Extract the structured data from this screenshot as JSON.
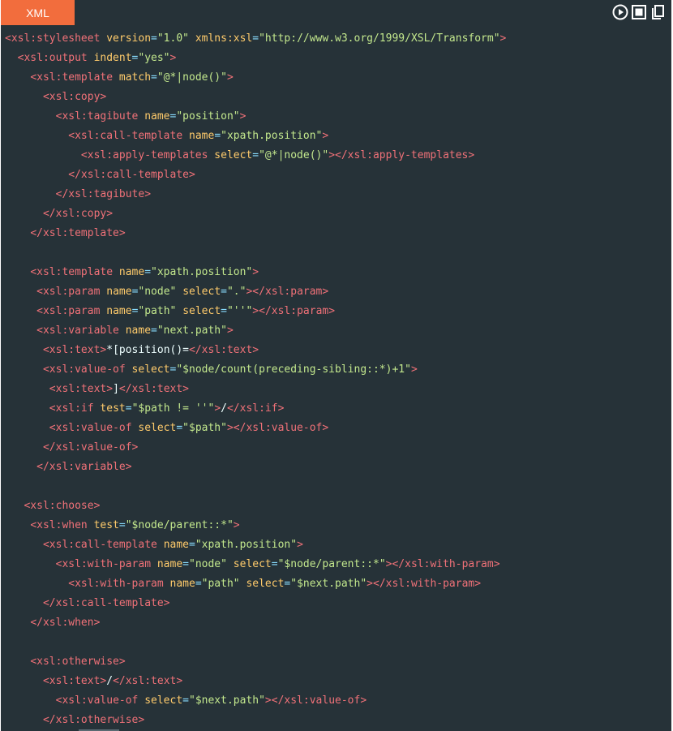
{
  "language_tab": "XML",
  "toolbar": [
    {
      "name": "run-icon"
    },
    {
      "name": "stop-icon"
    },
    {
      "name": "copy-icon"
    }
  ],
  "colors": {
    "background": "#263238",
    "tab": "#f26d3d",
    "tag": "#f07178",
    "attribute": "#ffcb6b",
    "punctuation": "#89ddff",
    "string": "#c3e88d",
    "text": "#eeffff"
  },
  "code_lines": [
    {
      "indent": 0,
      "parts": [
        [
          "tag",
          "<xsl:stylesheet"
        ],
        [
          "txt",
          " "
        ],
        [
          "attr",
          "version"
        ],
        [
          "punc",
          "="
        ],
        [
          "str",
          "\"1.0\""
        ],
        [
          "txt",
          " "
        ],
        [
          "attr",
          "xmlns:xsl"
        ],
        [
          "punc",
          "="
        ],
        [
          "str",
          "\"http://www.w3.org/1999/XSL/Transform\""
        ],
        [
          "tag",
          ">"
        ]
      ]
    },
    {
      "indent": 2,
      "parts": [
        [
          "tag",
          "<xsl:output"
        ],
        [
          "txt",
          " "
        ],
        [
          "attr",
          "indent"
        ],
        [
          "punc",
          "="
        ],
        [
          "str",
          "\"yes\""
        ],
        [
          "tag",
          ">"
        ]
      ]
    },
    {
      "indent": 4,
      "parts": [
        [
          "tag",
          "<xsl:template"
        ],
        [
          "txt",
          " "
        ],
        [
          "attr",
          "match"
        ],
        [
          "punc",
          "="
        ],
        [
          "str",
          "\"@*|node()\""
        ],
        [
          "tag",
          ">"
        ]
      ]
    },
    {
      "indent": 6,
      "parts": [
        [
          "tag",
          "<xsl:copy>"
        ]
      ]
    },
    {
      "indent": 8,
      "parts": [
        [
          "tag",
          "<xsl:tagibute"
        ],
        [
          "txt",
          " "
        ],
        [
          "attr",
          "name"
        ],
        [
          "punc",
          "="
        ],
        [
          "str",
          "\"position\""
        ],
        [
          "tag",
          ">"
        ]
      ]
    },
    {
      "indent": 10,
      "parts": [
        [
          "tag",
          "<xsl:call-template"
        ],
        [
          "txt",
          " "
        ],
        [
          "attr",
          "name"
        ],
        [
          "punc",
          "="
        ],
        [
          "str",
          "\"xpath.position\""
        ],
        [
          "tag",
          ">"
        ]
      ]
    },
    {
      "indent": 12,
      "parts": [
        [
          "tag",
          "<xsl:apply-templates"
        ],
        [
          "txt",
          " "
        ],
        [
          "attr",
          "select"
        ],
        [
          "punc",
          "="
        ],
        [
          "str",
          "\"@*|node()\""
        ],
        [
          "tag",
          "></xsl:apply-templates>"
        ]
      ]
    },
    {
      "indent": 10,
      "parts": [
        [
          "tag",
          "</xsl:call-template>"
        ]
      ]
    },
    {
      "indent": 8,
      "parts": [
        [
          "tag",
          "</xsl:tagibute>"
        ]
      ]
    },
    {
      "indent": 6,
      "parts": [
        [
          "tag",
          "</xsl:copy>"
        ]
      ]
    },
    {
      "indent": 4,
      "parts": [
        [
          "tag",
          "</xsl:template>"
        ]
      ]
    },
    {
      "indent": 0,
      "parts": []
    },
    {
      "indent": 4,
      "parts": [
        [
          "tag",
          "<xsl:template"
        ],
        [
          "txt",
          " "
        ],
        [
          "attr",
          "name"
        ],
        [
          "punc",
          "="
        ],
        [
          "str",
          "\"xpath.position\""
        ],
        [
          "tag",
          ">"
        ]
      ]
    },
    {
      "indent": 5,
      "parts": [
        [
          "tag",
          "<xsl:param"
        ],
        [
          "txt",
          " "
        ],
        [
          "attr",
          "name"
        ],
        [
          "punc",
          "="
        ],
        [
          "str",
          "\"node\""
        ],
        [
          "txt",
          " "
        ],
        [
          "attr",
          "select"
        ],
        [
          "punc",
          "="
        ],
        [
          "str",
          "\".\""
        ],
        [
          "tag",
          "></xsl:param>"
        ]
      ]
    },
    {
      "indent": 5,
      "parts": [
        [
          "tag",
          "<xsl:param"
        ],
        [
          "txt",
          " "
        ],
        [
          "attr",
          "name"
        ],
        [
          "punc",
          "="
        ],
        [
          "str",
          "\"path\""
        ],
        [
          "txt",
          " "
        ],
        [
          "attr",
          "select"
        ],
        [
          "punc",
          "="
        ],
        [
          "str",
          "\"''\""
        ],
        [
          "tag",
          "></xsl:param>"
        ]
      ]
    },
    {
      "indent": 5,
      "parts": [
        [
          "tag",
          "<xsl:variable"
        ],
        [
          "txt",
          " "
        ],
        [
          "attr",
          "name"
        ],
        [
          "punc",
          "="
        ],
        [
          "str",
          "\"next.path\""
        ],
        [
          "tag",
          ">"
        ]
      ]
    },
    {
      "indent": 6,
      "parts": [
        [
          "tag",
          "<xsl:text>"
        ],
        [
          "txt",
          "*[position()="
        ],
        [
          "tag",
          "</xsl:text>"
        ]
      ]
    },
    {
      "indent": 6,
      "parts": [
        [
          "tag",
          "<xsl:value-of"
        ],
        [
          "txt",
          " "
        ],
        [
          "attr",
          "select"
        ],
        [
          "punc",
          "="
        ],
        [
          "str",
          "\"$node/count(preceding-sibling::*)+1\""
        ],
        [
          "tag",
          ">"
        ]
      ]
    },
    {
      "indent": 7,
      "parts": [
        [
          "tag",
          "<xsl:text>"
        ],
        [
          "txt",
          "]"
        ],
        [
          "tag",
          "</xsl:text>"
        ]
      ]
    },
    {
      "indent": 7,
      "parts": [
        [
          "tag",
          "<xsl:if"
        ],
        [
          "txt",
          " "
        ],
        [
          "attr",
          "test"
        ],
        [
          "punc",
          "="
        ],
        [
          "str",
          "\"$path != ''\""
        ],
        [
          "tag",
          ">"
        ],
        [
          "txt",
          "/"
        ],
        [
          "tag",
          "</xsl:if>"
        ]
      ]
    },
    {
      "indent": 7,
      "parts": [
        [
          "tag",
          "<xsl:value-of"
        ],
        [
          "txt",
          " "
        ],
        [
          "attr",
          "select"
        ],
        [
          "punc",
          "="
        ],
        [
          "str",
          "\"$path\""
        ],
        [
          "tag",
          "></xsl:value-of>"
        ]
      ]
    },
    {
      "indent": 6,
      "parts": [
        [
          "tag",
          "</xsl:value-of>"
        ]
      ]
    },
    {
      "indent": 5,
      "parts": [
        [
          "tag",
          "</xsl:variable>"
        ]
      ]
    },
    {
      "indent": 0,
      "parts": []
    },
    {
      "indent": 3,
      "parts": [
        [
          "tag",
          "<xsl:choose>"
        ]
      ]
    },
    {
      "indent": 4,
      "parts": [
        [
          "tag",
          "<xsl:when"
        ],
        [
          "txt",
          " "
        ],
        [
          "attr",
          "test"
        ],
        [
          "punc",
          "="
        ],
        [
          "str",
          "\"$node/parent::*\""
        ],
        [
          "tag",
          ">"
        ]
      ]
    },
    {
      "indent": 6,
      "parts": [
        [
          "tag",
          "<xsl:call-template"
        ],
        [
          "txt",
          " "
        ],
        [
          "attr",
          "name"
        ],
        [
          "punc",
          "="
        ],
        [
          "str",
          "\"xpath.position\""
        ],
        [
          "tag",
          ">"
        ]
      ]
    },
    {
      "indent": 8,
      "parts": [
        [
          "tag",
          "<xsl:with-param"
        ],
        [
          "txt",
          " "
        ],
        [
          "attr",
          "name"
        ],
        [
          "punc",
          "="
        ],
        [
          "str",
          "\"node\""
        ],
        [
          "txt",
          " "
        ],
        [
          "attr",
          "select"
        ],
        [
          "punc",
          "="
        ],
        [
          "str",
          "\"$node/parent::*\""
        ],
        [
          "tag",
          "></xsl:with-param>"
        ]
      ]
    },
    {
      "indent": 10,
      "parts": [
        [
          "tag",
          "<xsl:with-param"
        ],
        [
          "txt",
          " "
        ],
        [
          "attr",
          "name"
        ],
        [
          "punc",
          "="
        ],
        [
          "str",
          "\"path\""
        ],
        [
          "txt",
          " "
        ],
        [
          "attr",
          "select"
        ],
        [
          "punc",
          "="
        ],
        [
          "str",
          "\"$next.path\""
        ],
        [
          "tag",
          "></xsl:with-param>"
        ]
      ]
    },
    {
      "indent": 6,
      "parts": [
        [
          "tag",
          "</xsl:call-template>"
        ]
      ]
    },
    {
      "indent": 4,
      "parts": [
        [
          "tag",
          "</xsl:when>"
        ]
      ]
    },
    {
      "indent": 0,
      "parts": []
    },
    {
      "indent": 4,
      "parts": [
        [
          "tag",
          "<xsl:otherwise>"
        ]
      ]
    },
    {
      "indent": 6,
      "parts": [
        [
          "tag",
          "<xsl:text>"
        ],
        [
          "txt",
          "/"
        ],
        [
          "tag",
          "</xsl:text>"
        ]
      ]
    },
    {
      "indent": 8,
      "parts": [
        [
          "tag",
          "<xsl:value-of"
        ],
        [
          "txt",
          " "
        ],
        [
          "attr",
          "select"
        ],
        [
          "punc",
          "="
        ],
        [
          "str",
          "\"$next.path\""
        ],
        [
          "tag",
          "></xsl:value-of>"
        ]
      ]
    },
    {
      "indent": 6,
      "parts": [
        [
          "tag",
          "</xsl:otherwise>"
        ]
      ]
    }
  ]
}
